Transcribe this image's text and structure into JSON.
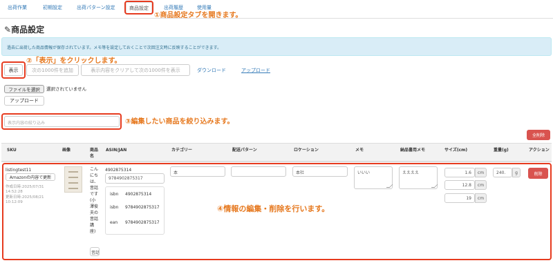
{
  "tabs": [
    "出荷作業",
    "初期設定",
    "出荷パターン設定",
    "商品設定",
    "出荷履歴",
    "使用量"
  ],
  "page_title": "商品設定",
  "info_text": "過去に出荷した商品情報が保存されています。メモ等を設定しておくことで次回注文時に反映することができます。",
  "toolbar": {
    "show": "表示",
    "add_next": "次の1000件を追加",
    "clear_show": "表示内容をクリアして次の1000件を表示",
    "download": "ダウンロード",
    "upload": "アップロード"
  },
  "file": {
    "choose": "ファイルを選択",
    "none": "選択されていません",
    "upload": "アップロード"
  },
  "filter_placeholder": "表示内容の絞り込み",
  "delete_all": "全削除",
  "columns": [
    "SKU",
    "画像",
    "商品名",
    "ASIN/JAN",
    "カテゴリー",
    "配送パターン",
    "ロケーション",
    "メモ",
    "納品書用メモ",
    "サイズ(cm)",
    "重量(g)",
    "アクション"
  ],
  "row": {
    "sku": "listingtest11",
    "update_amazon": "Amazonの内容で更新",
    "created_label": "作成日時:2025/07/31",
    "created_time": "14:52:28",
    "updated_label": "更新日時:2025/08/21",
    "updated_time": "10:12:09",
    "name_lines": [
      "こん",
      "にち",
      "は、",
      "昔話",
      "です",
      "(小",
      "澤俊",
      "夫の",
      "昔話",
      "講",
      "座)"
    ],
    "name_input": "昔話",
    "asin": "4902875314",
    "jan_input": "9784902875317",
    "codes": [
      {
        "type": "isbn",
        "value": "4902875314"
      },
      {
        "type": "isbn",
        "value": "9784902875317"
      },
      {
        "type": "ean",
        "value": "9784902875317"
      }
    ],
    "category": "本",
    "delivery": "",
    "location": "本社",
    "memo": "いいい",
    "invoice_memo": "ええええ",
    "size": [
      "1.6",
      "12.8",
      "19"
    ],
    "size_unit": "cm",
    "weight": "240.",
    "weight_unit": "g",
    "delete": "削除"
  },
  "annotations": {
    "a1": "①商品設定タブを開きます。",
    "a2": "②「表示」をクリックします。",
    "a3": "③編集したい商品を絞り込みます。",
    "a4": "④情報の編集・削除を行います。"
  },
  "colors": {
    "accent": "#e63a1e",
    "annotation": "#e6781e",
    "link": "#337ab7",
    "danger": "#d9534f",
    "info_bg": "#d9edf7"
  }
}
